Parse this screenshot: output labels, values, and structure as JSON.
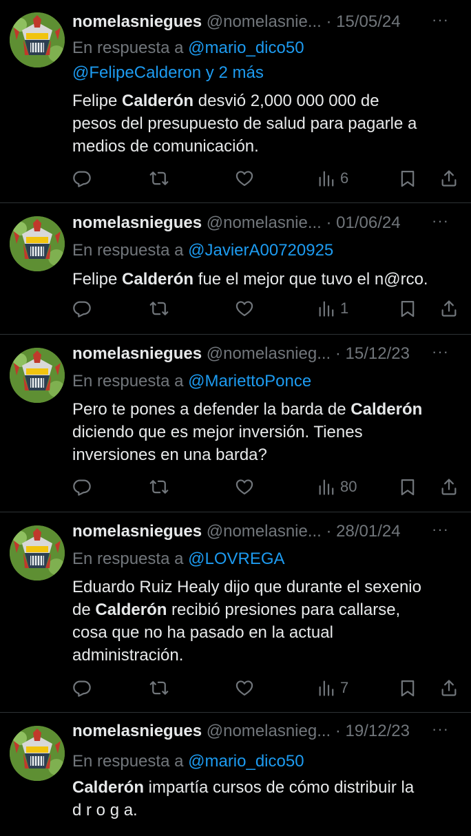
{
  "colors": {
    "background": "#000000",
    "text": "#e7e9ea",
    "muted": "#71767b",
    "link": "#1d9bf0",
    "divider": "#2f3336"
  },
  "tweets": [
    {
      "name": "nomelasniegues",
      "handle": "@nomelasnie...",
      "date": "15/05/24",
      "reply_prefix": "En respuesta a",
      "reply_mentions": "@mario_dico50",
      "reply_line2_mentions": "@FelipeCalderon",
      "reply_line2_suffix": " y 2 más",
      "text_lines": [
        [
          {
            "t": "Felipe "
          },
          {
            "t": "Calderón",
            "b": true
          },
          {
            "t": " desvió 2,000 000 000 de"
          }
        ],
        [
          {
            "t": "pesos del presupuesto de salud para pagarle a"
          }
        ],
        [
          {
            "t": "medios de comunicación."
          }
        ]
      ],
      "views": "6"
    },
    {
      "name": "nomelasniegues",
      "handle": "@nomelasnie...",
      "date": "01/06/24",
      "reply_prefix": "En respuesta a",
      "reply_mentions": "@JavierA00720925",
      "text_lines": [
        [
          {
            "t": "Felipe "
          },
          {
            "t": "Calderón",
            "b": true
          },
          {
            "t": " fue el mejor que tuvo el n@rco."
          }
        ]
      ],
      "views": "1"
    },
    {
      "name": "nomelasniegues",
      "handle": "@nomelasnieg...",
      "date": "15/12/23",
      "reply_prefix": "En respuesta a",
      "reply_mentions": "@MariettoPonce",
      "text_lines": [
        [
          {
            "t": "Pero te pones a defender la barda de "
          },
          {
            "t": "Calderón",
            "b": true
          }
        ],
        [
          {
            "t": "diciendo que es mejor inversión. Tienes"
          }
        ],
        [
          {
            "t": "inversiones en una barda?"
          }
        ]
      ],
      "views": "80"
    },
    {
      "name": "nomelasniegues",
      "handle": "@nomelasnie...",
      "date": "28/01/24",
      "reply_prefix": "En respuesta a",
      "reply_mentions": "@LOVREGA",
      "text_lines": [
        [
          {
            "t": "Eduardo Ruiz Healy dijo que durante el sexenio"
          }
        ],
        [
          {
            "t": "de "
          },
          {
            "t": "Calderón",
            "b": true
          },
          {
            "t": " recibió presiones para callarse,"
          }
        ],
        [
          {
            "t": "cosa que no ha pasado en la actual"
          }
        ],
        [
          {
            "t": "administración."
          }
        ]
      ],
      "views": "7"
    },
    {
      "name": "nomelasniegues",
      "handle": "@nomelasnieg...",
      "date": "19/12/23",
      "reply_prefix": "En respuesta a",
      "reply_mentions": "@mario_dico50",
      "text_lines": [
        [
          {
            "t": "Calderón",
            "b": true
          },
          {
            "t": " impartía cursos de cómo distribuir la"
          }
        ],
        [
          {
            "t": "d r o g a."
          }
        ]
      ],
      "views": ""
    }
  ]
}
